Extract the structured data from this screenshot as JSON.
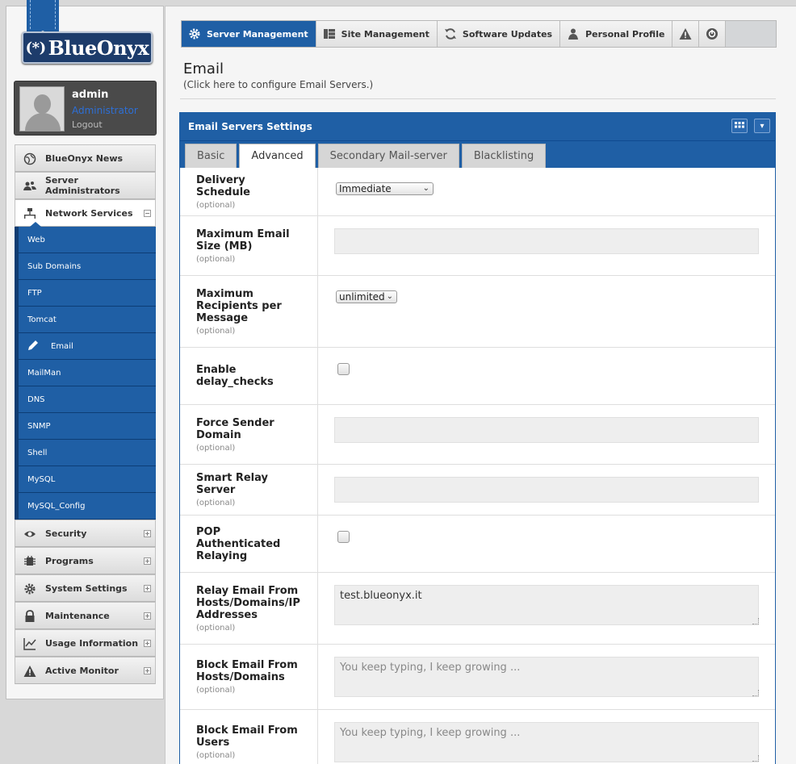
{
  "brand": {
    "logo_text": "BlueOnyx",
    "logo_mark": "(*)"
  },
  "user": {
    "name": "admin",
    "role": "Administrator",
    "logout": "Logout"
  },
  "nav": {
    "items": [
      {
        "label": "BlueOnyx News",
        "icon": "globe-icon"
      },
      {
        "label": "Server Administrators",
        "icon": "users-icon"
      },
      {
        "label": "Network Services",
        "icon": "network-icon"
      }
    ],
    "sub_items": [
      "Web",
      "Sub Domains",
      "FTP",
      "Tomcat",
      "Email",
      "MailMan",
      "DNS",
      "SNMP",
      "Shell",
      "MySQL",
      "MySQL_Config"
    ],
    "bottom_items": [
      {
        "label": "Security",
        "icon": "eye-icon"
      },
      {
        "label": "Programs",
        "icon": "chip-icon"
      },
      {
        "label": "System Settings",
        "icon": "gear-icon"
      },
      {
        "label": "Maintenance",
        "icon": "lock-icon"
      },
      {
        "label": "Usage Information",
        "icon": "chart-icon"
      },
      {
        "label": "Active Monitor",
        "icon": "warning-icon"
      }
    ]
  },
  "topnav": {
    "server_management": "Server Management",
    "site_management": "Site Management",
    "software_updates": "Software Updates",
    "personal_profile": "Personal Profile"
  },
  "page": {
    "title": "Email",
    "subtitle": "(Click here to configure Email Servers.)"
  },
  "box": {
    "title": "Email Servers Settings",
    "tabs": [
      "Basic",
      "Advanced",
      "Secondary Mail-server",
      "Blacklisting"
    ],
    "active_tab": "Advanced"
  },
  "form": {
    "optional": "(optional)",
    "delivery_schedule": {
      "label": "Delivery Schedule",
      "value": "Immediate"
    },
    "max_email_size": {
      "label": "Maximum Email Size (MB)",
      "value": ""
    },
    "max_recipients": {
      "label": "Maximum Recipients per Message",
      "value": "unlimited"
    },
    "delay_checks": {
      "label": "Enable delay_checks",
      "checked": false
    },
    "force_sender_domain": {
      "label": "Force Sender Domain",
      "value": ""
    },
    "smart_relay": {
      "label": "Smart Relay Server",
      "value": ""
    },
    "pop_relay": {
      "label": "POP Authenticated Relaying",
      "checked": false
    },
    "relay_from": {
      "label": "Relay Email From Hosts/Domains/IP Addresses",
      "value": "test.blueonyx.it"
    },
    "block_hosts": {
      "label": "Block Email From Hosts/Domains",
      "placeholder": "You keep typing, I keep growing ..."
    },
    "block_users": {
      "label": "Block Email From Users",
      "placeholder": "You keep typing, I keep growing ..."
    }
  }
}
